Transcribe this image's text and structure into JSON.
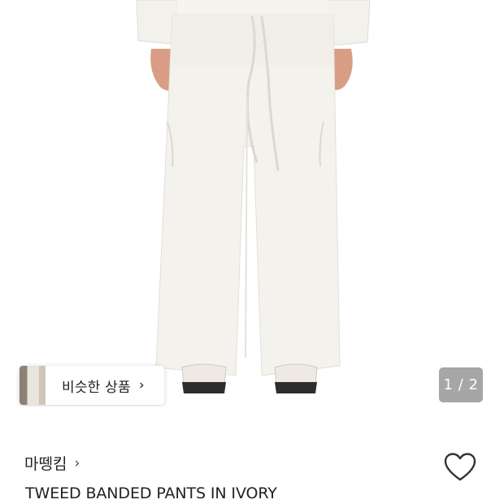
{
  "similar_products": {
    "label": "비슷한 상품",
    "chevron_icon": "chevron-right-icon"
  },
  "pager": {
    "current": "1",
    "total": "2",
    "text": "1 / 2"
  },
  "product": {
    "brand": "마뗑킴",
    "name": "TWEED BANDED PANTS IN IVORY",
    "like_icon": "heart-outline-icon"
  }
}
